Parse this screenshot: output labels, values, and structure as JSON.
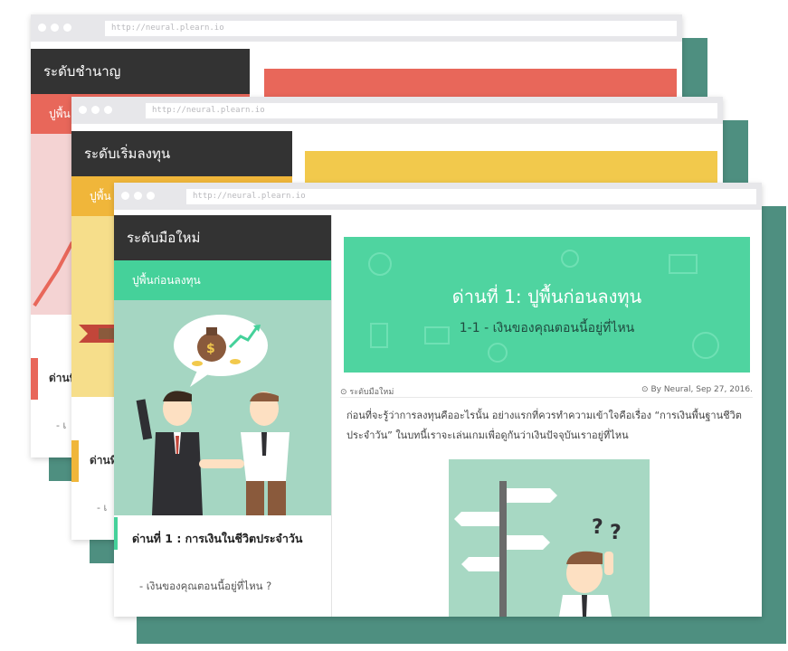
{
  "url": "http://neural.plearn.io",
  "windows": {
    "expert": {
      "sidebar_title": "ระดับชำนาญ",
      "strip_label": "ปูพื้น",
      "stage_label": "ด่านที่",
      "item_label": "- เ"
    },
    "starter": {
      "sidebar_title": "ระดับเริ่มลงทุน",
      "strip_label": "ปูพื้น",
      "stage_label": "ด่านที่",
      "item_label": "- เ"
    },
    "beginner": {
      "sidebar_title": "ระดับมือใหม่",
      "strip_label": "ปูพื้นก่อนลงทุน",
      "lesson_title": "ด่านที่ 1 : การเงินในชีวิตประจำวัน",
      "lesson_item": "- เงินของคุณตอนนี้อยู่ที่ไหน ?",
      "banner_title": "ด่านที่ 1: ปูพื้นก่อนลงทุน",
      "banner_subtitle": "1-1 - เงินของคุณตอนนี้อยู่ที่ไหน",
      "category": "ระดับมือใหม่",
      "byline": "By Neural, Sep 27, 2016.",
      "body": "ก่อนที่จะรู้ว่าการลงทุนคืออะไรนั้น อย่างแรกที่ควรทำความเข้าใจคือเรื่อง “การเงินพื้นฐานชีวิตประจำวัน” ในบทนี้เราจะเล่นเกมเพื่อดูกันว่าเงินปัจจุบันเราอยู่ที่ไหน"
    }
  },
  "colors": {
    "expert": "#e8675a",
    "starter": "#f2c94c",
    "beginner": "#4fd4a0",
    "shadow": "#4e8f80"
  },
  "icons": [
    "clock-icon",
    "tag-icon",
    "money-bag-icon",
    "question-mark-icon",
    "signpost-icon"
  ]
}
